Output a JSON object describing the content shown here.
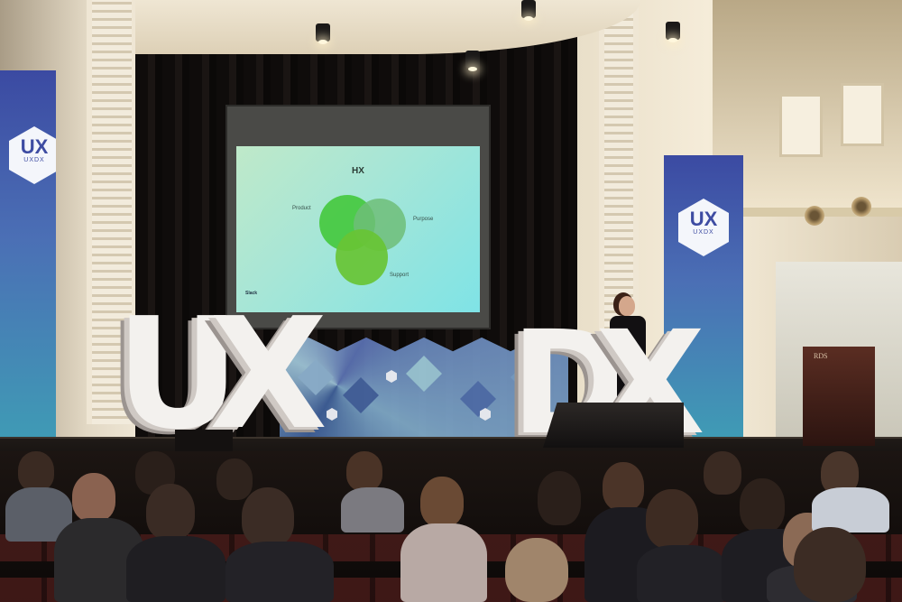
{
  "slide": {
    "title": "HX",
    "labels": {
      "product": "Product",
      "purpose": "Purpose",
      "support": "Support"
    },
    "logo": "Slack"
  },
  "banners": {
    "logo_mark": "UX",
    "logo_caption": "UXDX"
  },
  "stage_letters": {
    "left_u": "U",
    "left_x": "X",
    "right_d": "D",
    "right_x": "X"
  },
  "lectern": {
    "label": "RDS"
  },
  "colors": {
    "banner_top": "#3b4aa2",
    "banner_bottom": "#3f9bb5",
    "slide_background": "#a8e6d6",
    "venn_product": "#4ccf4e",
    "venn_purpose": "#72c98a",
    "venn_support": "#6cc53a",
    "curtain": "#0f0c0b"
  }
}
